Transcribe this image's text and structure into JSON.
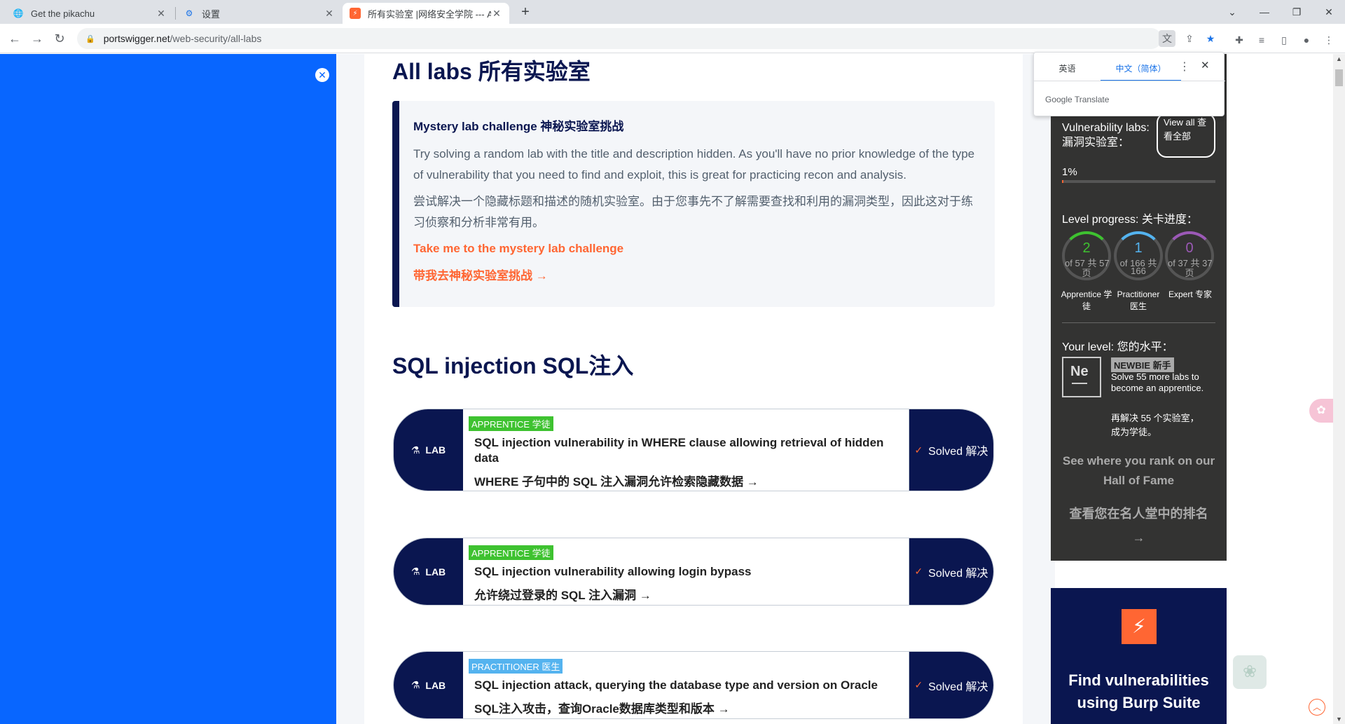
{
  "browser": {
    "tabs": [
      {
        "title": "Get the pikachu",
        "icon": "globe-icon",
        "close": "✕"
      },
      {
        "title": "设置",
        "icon": "gear-icon",
        "close": "✕"
      },
      {
        "title": "所有实验室 |网络安全学院 --- A",
        "icon": "portswigger-icon",
        "close": "✕"
      }
    ],
    "new_tab": "+",
    "url_host": "portswigger.net",
    "url_path": "/web-security/all-labs"
  },
  "translate_popup": {
    "source_lang": "英语",
    "target_lang": "中文（简体）",
    "brand": "Google Translate"
  },
  "page": {
    "title": "All labs 所有实验室",
    "mystery": {
      "heading": "Mystery lab challenge 神秘实验室挑战",
      "desc_en": "Try solving a random lab with the title and description hidden. As you'll have no prior knowledge of the type of vulnerability that you need to find and exploit, this is great for practicing recon and analysis.",
      "desc_cn": "尝试解决一个隐藏标题和描述的随机实验室。由于您事先不了解需要查找和利用的漏洞类型，因此这对于练习侦察和分析非常有用。",
      "cta_en": "Take me to the mystery lab challenge",
      "cta_cn": "带我去神秘实验室挑战 →"
    },
    "section_title": "SQL injection SQL注入",
    "labs": [
      {
        "tag": "LAB",
        "level": "APPRENTICE 学徒",
        "title_en": "SQL injection vulnerability in WHERE clause allowing retrieval of hidden data",
        "title_cn": "WHERE 子句中的 SQL 注入漏洞允许检索隐藏数据 →",
        "status": "Solved 解决"
      },
      {
        "tag": "LAB",
        "level": "APPRENTICE 学徒",
        "title_en": "SQL injection vulnerability allowing login bypass",
        "title_cn": "允许绕过登录的 SQL 注入漏洞 →",
        "status": "Solved 解决"
      },
      {
        "tag": "LAB",
        "level": "PRACTITIONER 医生",
        "title_en": "SQL injection attack, querying the database type and version on Oracle",
        "title_cn": "SQL注入攻击，查询Oracle数据库类型和版本 →",
        "status": "Solved 解决"
      }
    ]
  },
  "sidebar": {
    "vuln_labs": "Vulnerability labs: 漏洞实验室：",
    "view_all": "View all 查看全部",
    "percent": "1%",
    "progress_fraction": 0.01,
    "level_progress": "Level progress: 关卡进度：",
    "rings": [
      {
        "count": "2",
        "of_line1": "of 57 共 57",
        "of_line2": "页",
        "label": "Apprentice 学徒",
        "color": "#3ec230"
      },
      {
        "count": "1",
        "of_line1": "of 166 共",
        "of_line2": "166",
        "label": "Practitioner 医生",
        "color": "#54b3ef"
      },
      {
        "count": "0",
        "of_line1": "of 37 共 37",
        "of_line2": "页",
        "label": "Expert 专家",
        "color": "#9b59b6"
      }
    ],
    "your_level": "Your level: 您的水平：",
    "level_badge": "Ne",
    "newbie": "NEWBIE 新手",
    "solve_more_en": "Solve 55 more labs to become an apprentice.",
    "solve_more_cn": "再解决 55 个实验室，成为学徒。",
    "hall_en": "See where you rank on our Hall of Fame",
    "hall_cn": "查看您在名人堂中的排名",
    "hall_arrow": "→",
    "burp_find": "Find vulnerabilities using Burp Suite"
  }
}
